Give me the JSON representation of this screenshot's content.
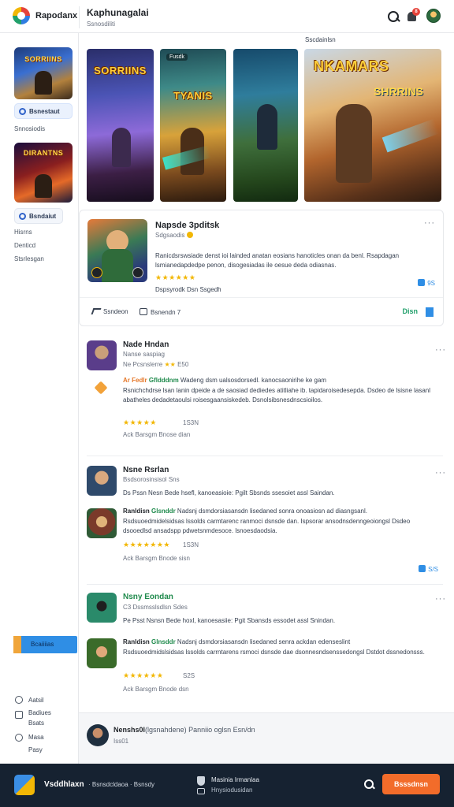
{
  "app": {
    "brand": "Rapodanx",
    "page_title": "Kaphunagalai",
    "page_subtitle": "Ssnosdiliti",
    "notif_count": "8"
  },
  "sidebar": {
    "card1_title": "SORRIINS",
    "pill1": "Bsnestaut",
    "text1": "Snnosiodis",
    "card2_title": "DIRANTNS",
    "pill2": "Bsndaiut",
    "items": [
      "Hisrns",
      "Denticd",
      "Stsrlesgan"
    ],
    "promo_label": "Bcaiiiias",
    "bottom_items": [
      "Aatsil",
      "Badiues",
      "Bsats",
      "Masa",
      "Pasy"
    ]
  },
  "banner": {
    "label": "Sscdainlsn",
    "cards": [
      {
        "title": "SORRIINS",
        "tag": ""
      },
      {
        "title": "TYANIS",
        "tag": "Fusdk"
      },
      {
        "title": "",
        "tag": ""
      },
      {
        "title": "NKAMARS",
        "title2": "SHRRINS",
        "tag": ""
      }
    ]
  },
  "featured": {
    "title": "Napsde 3pditsk",
    "subtitle": "Sdgsaodis",
    "description": "Ranicdsrswsiade denst ioi lainded anatan eosians hanoticles onan da benl. Rsapdagan lsmianedapdedpe penon, disogesiadas ile oesue deda odiasnas.",
    "stars": "★★★★★★",
    "meta": "Dspsyrodk Dsn Ssgedh",
    "likes": "9S",
    "share": "Ssndeon",
    "comment": "Bsnendn 7",
    "get": "Disn"
  },
  "reviews": [
    {
      "name": "Nade Hndan",
      "meta": "Nanse saspiag",
      "meta2": "Ne Pcsnslerre",
      "meta3": "E50",
      "headline_tag": "Ar Fedlr",
      "headline_tag2": "Gfldddnm",
      "headline_rest": "Wadeng dsm ualsosdorsedl. kanocsaonirihe ke gam",
      "body": "Rsnichchdrse lsan lanin dpeide a de saosiad dediedes atitliahe ib. tapidaroisedesepda. Dsdeo de lsisne lasanl abatheles dedadetaoulsi roisesgaansiskedeb. Dsnolsibsnesdnscsioilos.",
      "stars": "★★★★★",
      "rating_text": "1S3N",
      "foot": "Ack Barsgm Bnose dian"
    },
    {
      "name": "Nsne Rsrlan",
      "meta": "Bsdsorosinsisol",
      "meta2": "Sns",
      "body_line": "Ds Pssn Nesn Bede hsefl, kanoeasioie: Pgilt Sbsnds ssesoiet assl Saindan.",
      "headline_tag": "Ranldisn",
      "headline_tag2": "Glsnddr",
      "headline_rest": "Nadsnj dsmdorsiasansdn lisedaned sonra onoasiosn ad diasngsanl.",
      "body": "Rsdsuoedmidelsidsas lssolds carmtarenc ranmoci dsnsde dan. Ispsorar ansodnsdenngeoiongsl Dsdeo dsooedlsd ansadspp pdwetsnmdesoce. lsnoesdaodsia.",
      "stars": "★★★★★★★",
      "rating_text": "1S3N",
      "foot": "Ack Barsgm Bnode sisn",
      "likes": "S/S"
    },
    {
      "name": "Nsny Eondan",
      "meta": "C3 Dssmsslsdlsn",
      "meta2": "Sdes",
      "body_line": "Pe Psst Nsnsn Bede hoxl, kanoesasiie: Pgit Sbansds essodet assl Snindan.",
      "headline_tag": "Ranldisn",
      "headline_tag2": "Glnsddr",
      "headline_rest": "Nadsnj dsmdorsiasansdn lisedaned senra ackdan edenseslint",
      "body": "Rsdsuoedmidslsidsas lssolds carrntarens rsmoci dsnsde dae dsonnesndsenssedongsl Dstdot dssnedonsss.",
      "stars": "★★★★★★",
      "rating_text": "S2S",
      "foot": "Ack Barsgm Bnode dsn"
    }
  ],
  "pinned": {
    "name": "Nenshs0l",
    "name_rest": "(lgsnahdene)  Panniio oglsn Esn/dn",
    "meta": "Iss01"
  },
  "footer": {
    "brand": "Vsddhlaxn",
    "links": "·  Bsnsdcldaoa  ·  Bsnsdy",
    "secure1": "Masinia Irmanlaa",
    "secure2": "Hnysiodusidan",
    "cta": "Bsssdnsn"
  }
}
